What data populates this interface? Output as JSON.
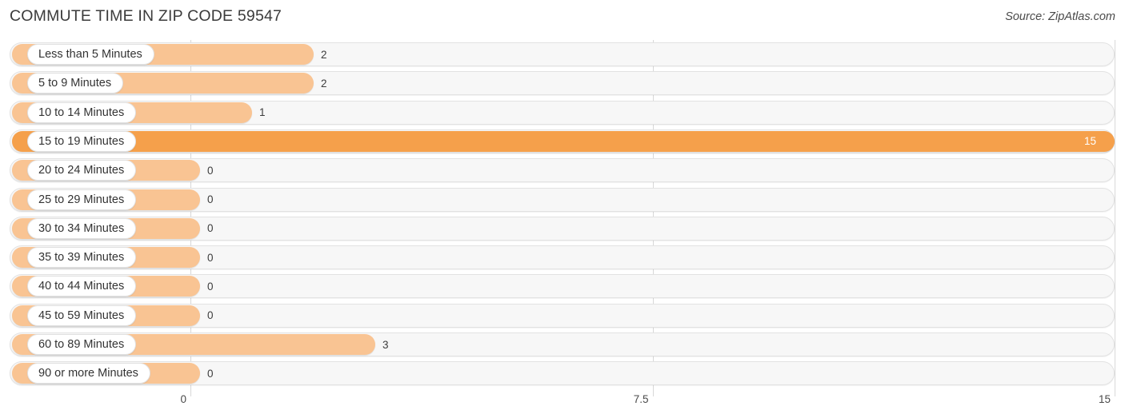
{
  "header": {
    "title": "COMMUTE TIME IN ZIP CODE 59547",
    "source": "Source: ZipAtlas.com"
  },
  "colors": {
    "bar": "#F9C493",
    "bar_highlight": "#F5A04B",
    "track": "#F7F7F7",
    "track_border": "#E2E2E2",
    "gridline": "#D8D8D8",
    "text": "#333333",
    "value_inside": "#FFFFFF"
  },
  "chart_data": {
    "type": "bar",
    "orientation": "horizontal",
    "title": "COMMUTE TIME IN ZIP CODE 59547",
    "xlabel": "",
    "ylabel": "",
    "xlim": [
      0,
      15
    ],
    "ticks": [
      "0",
      "7.5",
      "15"
    ],
    "tick_values": [
      0,
      7.5,
      15
    ],
    "grid": true,
    "legend": null,
    "categories": [
      "Less than 5 Minutes",
      "5 to 9 Minutes",
      "10 to 14 Minutes",
      "15 to 19 Minutes",
      "20 to 24 Minutes",
      "25 to 29 Minutes",
      "30 to 34 Minutes",
      "35 to 39 Minutes",
      "40 to 44 Minutes",
      "45 to 59 Minutes",
      "60 to 89 Minutes",
      "90 or more Minutes"
    ],
    "values": [
      2,
      2,
      1,
      15,
      0,
      0,
      0,
      0,
      0,
      0,
      3,
      0
    ],
    "value_labels": [
      "2",
      "2",
      "1",
      "15",
      "0",
      "0",
      "0",
      "0",
      "0",
      "0",
      "3",
      "0"
    ],
    "highlight_index": 3
  }
}
